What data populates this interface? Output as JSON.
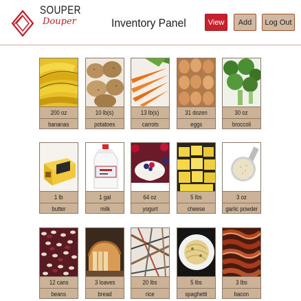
{
  "app": {
    "logo_top": "SOUPER",
    "logo_bottom": "Douper",
    "title": "Inventory Panel"
  },
  "buttons": {
    "view": "View",
    "add": "Add",
    "logout": "Log Out"
  },
  "colors": {
    "accent": "#c9202e",
    "button_bg": "#cfb9a3",
    "card_label_bg": "#ccb398",
    "divider": "#d9a3a3"
  },
  "items": [
    {
      "qty": "200 oz",
      "name": "bananas",
      "icon": "bananas-photo"
    },
    {
      "qty": "10 lb(s)",
      "name": "potatoes",
      "icon": "potatoes-photo"
    },
    {
      "qty": "13 lb(s)",
      "name": "carrots",
      "icon": "carrots-photo"
    },
    {
      "qty": "31 dozen",
      "name": "eggs",
      "icon": "eggs-photo"
    },
    {
      "qty": "30 oz",
      "name": "broccoli",
      "icon": "broccoli-photo"
    },
    {
      "qty": "1 lb",
      "name": "butter",
      "icon": "butter-photo"
    },
    {
      "qty": "1 gal",
      "name": "milk",
      "icon": "milk-photo"
    },
    {
      "qty": "64 oz",
      "name": "yogurt",
      "icon": "yogurt-photo"
    },
    {
      "qty": "5 lbs",
      "name": "cheese",
      "icon": "cheese-photo"
    },
    {
      "qty": "3 oz",
      "name": "garlic powder",
      "icon": "garlic-powder-photo"
    },
    {
      "qty": "12 cans",
      "name": "beans",
      "icon": "beans-photo"
    },
    {
      "qty": "3 loaves",
      "name": "bread",
      "icon": "bread-photo"
    },
    {
      "qty": "20 lbs",
      "name": "rice",
      "icon": "rice-photo"
    },
    {
      "qty": "5 lbs",
      "name": "spaghetti",
      "icon": "spaghetti-photo"
    },
    {
      "qty": "3 lbs",
      "name": "bacon",
      "icon": "bacon-photo"
    }
  ]
}
